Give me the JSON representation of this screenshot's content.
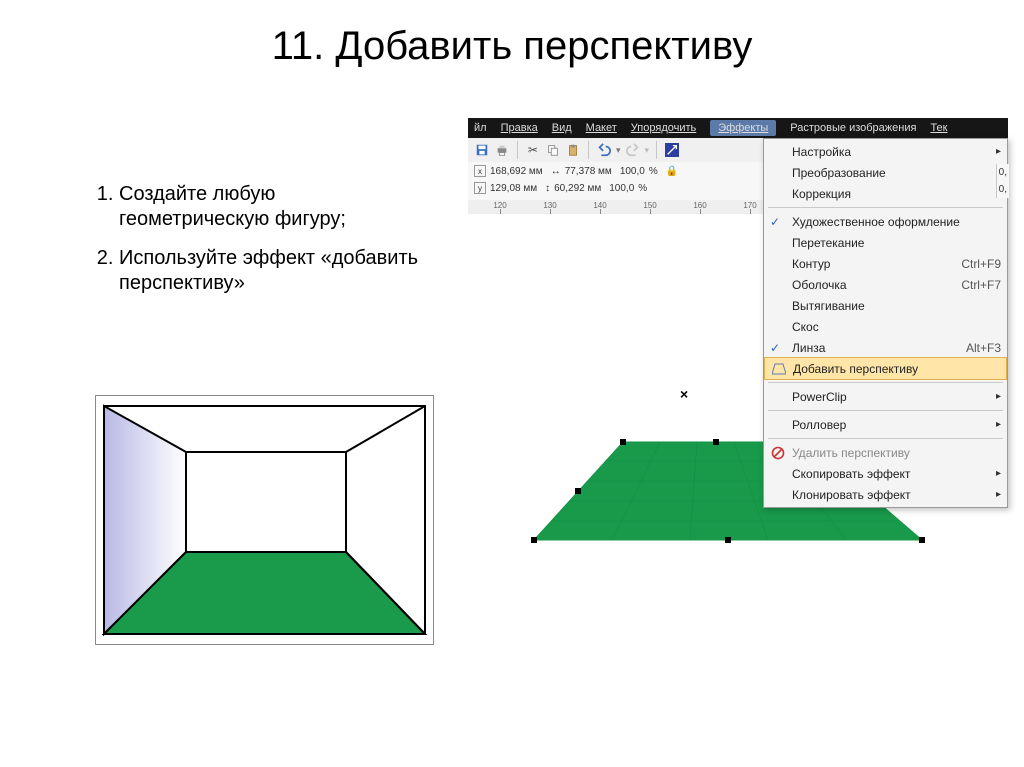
{
  "title": "11. Добавить перспективу",
  "instructions": {
    "item1": "Создайте любую геометрическую фигуру;",
    "item2": "Используйте эффект «добавить перспективу»"
  },
  "app": {
    "menubar": {
      "file_tail": "йл",
      "edit": "Правка",
      "view": "Вид",
      "layout": "Макет",
      "arrange": "Упорядочить",
      "effects": "Эффекты",
      "bitmap": "Растровые изображения",
      "text_tail": "Тек"
    },
    "propbar": {
      "x": "168,692 мм",
      "y": "129,08 мм",
      "w_icon": "↔",
      "h_icon": "↕",
      "w": "77,378 мм",
      "h": "60,292 мм",
      "sx": "100,0",
      "sy": "100,0",
      "pct": "%",
      "lock": "🔒",
      "sx2": "0,",
      "sy2": "0,"
    },
    "ruler": {
      "t120": "120",
      "t130": "130",
      "t140": "140",
      "t150": "150",
      "t160": "160",
      "t170": "170"
    },
    "menu": {
      "adjust": "Настройка",
      "transform": "Преобразование",
      "correction": "Коррекция",
      "artistic": "Художественное оформление",
      "blend": "Перетекание",
      "contour": "Контур",
      "contour_sc": "Ctrl+F9",
      "envelope": "Оболочка",
      "envelope_sc": "Ctrl+F7",
      "extrude": "Вытягивание",
      "bevel": "Скос",
      "lens": "Линза",
      "lens_sc": "Alt+F3",
      "add_perspective": "Добавить перспективу",
      "powerclip": "PowerClip",
      "rollover": "Ролловер",
      "clear_persp": "Удалить перспективу",
      "copy_effect": "Скопировать эффект",
      "clone_effect": "Клонировать эффект"
    }
  }
}
